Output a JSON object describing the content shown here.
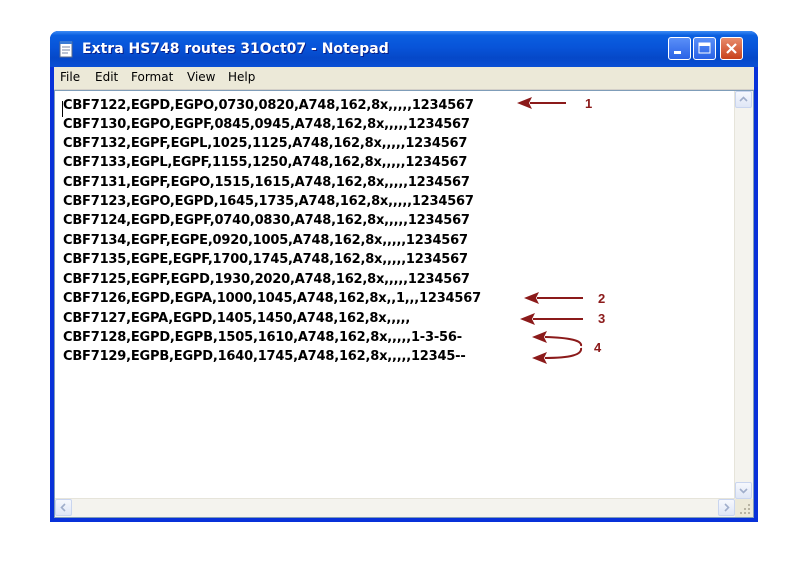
{
  "window": {
    "title": "Extra HS748 routes 31Oct07 - Notepad"
  },
  "menu": [
    {
      "label": "File"
    },
    {
      "label": "Edit"
    },
    {
      "label": "Format"
    },
    {
      "label": "View"
    },
    {
      "label": "Help"
    }
  ],
  "icons": {
    "app": "notepad-icon",
    "minimize": "minimize-icon",
    "maximize": "maximize-icon",
    "close": "close-icon"
  },
  "lines": [
    "CBF7122,EGPD,EGPO,0730,0820,A748,162,8x,,,,,1234567",
    "CBF7130,EGPO,EGPF,0845,0945,A748,162,8x,,,,,1234567",
    "CBF7132,EGPF,EGPL,1025,1125,A748,162,8x,,,,,1234567",
    "CBF7133,EGPL,EGPF,1155,1250,A748,162,8x,,,,,1234567",
    "CBF7131,EGPF,EGPO,1515,1615,A748,162,8x,,,,,1234567",
    "CBF7123,EGPO,EGPD,1645,1735,A748,162,8x,,,,,1234567",
    "CBF7124,EGPD,EGPF,0740,0830,A748,162,8x,,,,,1234567",
    "CBF7134,EGPF,EGPE,0920,1005,A748,162,8x,,,,,1234567",
    "CBF7135,EGPE,EGPF,1700,1745,A748,162,8x,,,,,1234567",
    "CBF7125,EGPF,EGPD,1930,2020,A748,162,8x,,,,,1234567",
    "CBF7126,EGPD,EGPA,1000,1045,A748,162,8x,,1,,,1234567",
    "CBF7127,EGPA,EGPD,1405,1450,A748,162,8x,,,,,",
    "CBF7128,EGPD,EGPB,1505,1610,A748,162,8x,,,,,1-3-56-",
    "CBF7129,EGPB,EGPD,1640,1745,A748,162,8x,,,,,12345--"
  ],
  "annotations": {
    "color": "#8b1a1a",
    "labels": [
      "1",
      "2",
      "3",
      "4"
    ]
  }
}
